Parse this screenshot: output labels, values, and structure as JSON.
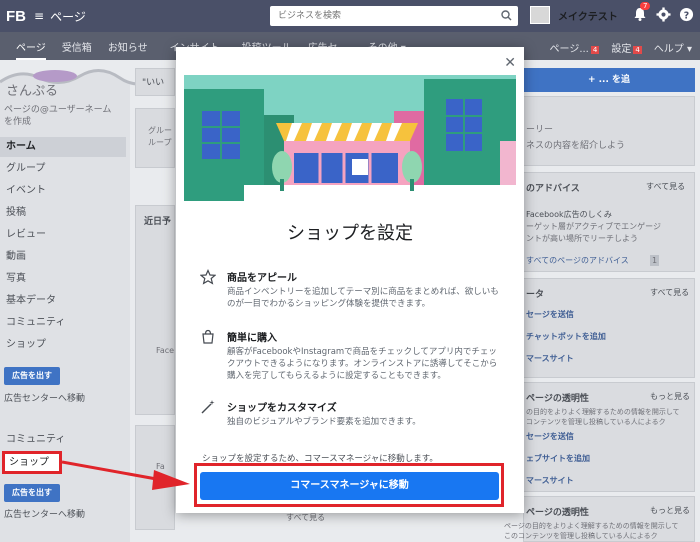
{
  "topbar": {
    "logo": "FB",
    "menu_glyph": "≡",
    "page_title": "ページ",
    "search_placeholder": "ビジネスを検索",
    "account_name": "メイクテスト",
    "notif_count": "7"
  },
  "tabs": [
    {
      "label": "ページ"
    },
    {
      "label": "受信箱"
    },
    {
      "label": "お知らせ"
    },
    {
      "label": "インサイト"
    },
    {
      "label": "投稿ツール"
    },
    {
      "label": "広告セ"
    },
    {
      "label": "その他 ▾"
    }
  ],
  "tabs_right": {
    "page_label": "ページ...",
    "page_badge": "4",
    "settings_label": "設定",
    "settings_badge": "4",
    "help_label": "ヘルプ ▾"
  },
  "left": {
    "page_name": "さんぷる",
    "username_line1": "ページの@ユーザーネーム",
    "username_line2": "を作成",
    "nav": [
      "ホーム",
      "グループ",
      "イベント",
      "投稿",
      "レビュー",
      "動画",
      "写真",
      "基本データ",
      "コミュニティ",
      "ショップ"
    ],
    "ad_button": "広告を出す",
    "ad_center": "広告センターへ移動",
    "nav2": [
      "コミュニティ",
      "ショップ"
    ],
    "ad_button2": "広告を出す",
    "ad_center2": "広告センターへ移動"
  },
  "mid": {
    "fragment_iine": "\"いい",
    "fragment_group": "グルー",
    "fragment_group2": "ループ",
    "fragment_upcoming": "近日予",
    "fragment_face": "Face",
    "fragment_fa": "Fa",
    "see_all": "すべて見る"
  },
  "right": {
    "create_btn": "+ ... を追",
    "fragment_story": "ーリー",
    "fragment_story2": "ネスの内容を紹介しよう",
    "advice_title": "のアドバイス",
    "see_all": "すべて見る",
    "advice_text1": "Facebook広告のしくみ",
    "advice_text2": "ーゲット層がアクティブでエンゲージ",
    "advice_text3": "ントが高い場所でリーチしよう",
    "all_advice": "すべてのページのアドバイス",
    "all_advice_badge": "1",
    "data_title": "ータ",
    "data_see": "すべて見る",
    "msg_link": "セージを送信",
    "chat_link": "チャットボットを追加",
    "commerce_link": "マースサイト",
    "trans_title": "ページの透明性",
    "trans_more": "もっと見る",
    "trans_text1": "の目的をよりよく理解するための情報を開示して",
    "trans_text2": "コンテンツを管理し投稿している人によるク",
    "msg_link2": "セージを送信",
    "chat_link2": "ェブサイトを追加",
    "commerce_link2": "マースサイト",
    "trans_title2": "ページの透明性",
    "trans_more2": "もっと見る",
    "trans_text3": "ページの目的をよりよく理解するための情報を開示して",
    "trans_text4": "このコンテンツを管理し投稿している人によるク"
  },
  "modal": {
    "title": "ショップを設定",
    "features": [
      {
        "icon": "star-icon",
        "title": "商品をアピール",
        "desc": "商品インベントリーを追加してテーマ別に商品をまとめれば、欲しいものが一目でわかるショッピング体験を提供できます。"
      },
      {
        "icon": "shopping-bag-icon",
        "title": "簡単に購入",
        "desc": "顧客がFacebookやInstagramで商品をチェックしてアプリ内でチェックアウトできるようになります。オンラインストアに誘導してそこから購入を完了してもらえるように設定することもできます。"
      },
      {
        "icon": "magic-wand-icon",
        "title": "ショップをカスタマイズ",
        "desc": "独自のビジュアルやブランド要素を追加できます。"
      }
    ],
    "note": "ショップを設定するため、コマースマネージャに移動します。",
    "cta": "コマースマネージャに移動"
  },
  "colors": {
    "accent": "#1877f2",
    "highlight": "#e0242a"
  }
}
